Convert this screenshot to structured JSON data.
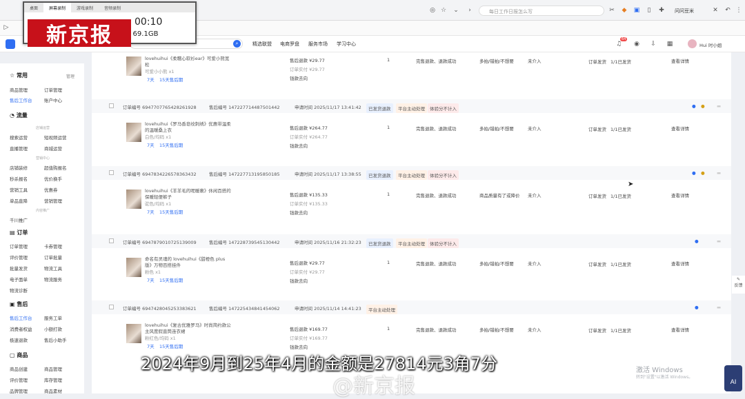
{
  "recorder": {
    "tabs": [
      "桌面",
      "屏幕录制",
      "游戏录制",
      "音频录制"
    ],
    "timer": "00:10",
    "storage": "/ 69.1GB"
  },
  "news_logo": "新京报",
  "browser": {
    "search_placeholder": "每日工作日报怎么写",
    "ext_text": "问问豆米"
  },
  "app": {
    "nav": [
      "精选联盟",
      "电商罗盘",
      "服务市场",
      "学习中心"
    ],
    "notif_count": "64",
    "user": "Hui 时小姐"
  },
  "sidebar": {
    "sections": [
      {
        "title": "常用",
        "extra": "管理"
      },
      {
        "title": "流量"
      },
      {
        "title": "订单"
      },
      {
        "title": "售后"
      },
      {
        "title": "商品"
      }
    ],
    "items_common": [
      "商品管理",
      "订单管理",
      "售后工作台",
      "账户中心"
    ],
    "items_traffic": [
      "搜索运营",
      "短视频运营",
      "直播管理",
      "商城运营",
      "店铺装修",
      "超值购报名",
      "秒杀报名",
      "优价换手",
      "营销工具",
      "优惠券",
      "单品直降",
      "营销管理",
      "千川推广"
    ],
    "hints": [
      "店铺运营",
      "营销中心",
      "内容推广"
    ],
    "items_order": [
      "订单管理",
      "卡券管理",
      "评价管理",
      "订单批量",
      "批量发货",
      "物流工具",
      "电子面单",
      "物流服务",
      "物流诊断"
    ],
    "items_after": [
      "售后工作台",
      "服务工单",
      "消费者权益",
      "小额打款",
      "极速退款",
      "售后小助手"
    ],
    "items_goods": [
      "商品创建",
      "商品管理",
      "评价管理",
      "库存管理",
      "品牌管理",
      "商品素材"
    ]
  },
  "orders": [
    {
      "order_no": "",
      "after_no": "",
      "apply_time": "",
      "badges": [],
      "title": "lovehuihui《柔糯心软衫ear》可爱小熊宽松",
      "spec": "可爱小小熊 x1",
      "days": "7天",
      "note": "15天售后期",
      "refund": "售后退款 ¥29.77",
      "paid": "订单实付 ¥29.77",
      "route": "钱款去向",
      "qty": "1",
      "status": "完售退款、退款成功",
      "reason": "多拍/错拍/不想要",
      "intervene": "未介入",
      "logistics": "订单发货",
      "progress": "1/1已发货",
      "action": "查看详情"
    },
    {
      "order_no": "订单编号 6947707765428261928",
      "after_no": "售后编号 147227714487501442",
      "apply_time": "申请时间 2025/11/17 13:41:42",
      "badges": [
        "已发货退款",
        "平台主动处理",
        "体验分不计入"
      ],
      "title": "lovehuihui《罗马香皂纹刺绣》优惠带温柔的温暖桑上衣",
      "spec": "白色/均码 x1",
      "days": "7天",
      "note": "15天售后期",
      "refund": "售后退款 ¥264.77",
      "paid": "订单实付 ¥264.77",
      "route": "钱款去向",
      "qty": "1",
      "status": "完售退款、退款成功",
      "reason": "多拍/错拍/不想要",
      "intervene": "未介入",
      "logistics": "订单发货",
      "progress": "1/1已发货",
      "action": "查看详情"
    },
    {
      "order_no": "订单编号 6947834226578363432",
      "after_no": "售后编号 147227713195850185",
      "apply_time": "申请时间 2025/11/17 13:38:55",
      "badges": [
        "已发货退款",
        "平台主动处理",
        "体验分不计入"
      ],
      "title": "lovehuihui《羊羊毛的呢暖裹》休闲百搭的保暖轻便裤子",
      "spec": "驼色/均码 x1",
      "days": "7天",
      "note": "15天售后期",
      "refund": "售后退款 ¥135.33",
      "paid": "订单实付 ¥135.33",
      "route": "钱款去向",
      "qty": "1",
      "status": "完售退款、退款成功",
      "reason": "商品质量有了或降价",
      "intervene": "未介入",
      "logistics": "订单发货",
      "progress": "1/1已发货",
      "action": "查看详情"
    },
    {
      "order_no": "订单编号 6947879010725139009",
      "after_no": "售后编号 147228739545130442",
      "apply_time": "申请时间 2025/11/16 21:32:23",
      "badges": [
        "已发货退款",
        "平台主动处理",
        "体验分不计入"
      ],
      "title": "命名有灵魂的 lovehuihui《甜橙色 plus版》万物百搭挂件",
      "spec": "粉色 x1",
      "days": "7天",
      "note": "15天售后期",
      "refund": "售后退款 ¥29.77",
      "paid": "订单实付 ¥29.77",
      "route": "钱款去向",
      "qty": "1",
      "status": "完售退款、退款成功",
      "reason": "多拍/错拍/不想要",
      "intervene": "未介入",
      "logistics": "订单发货",
      "progress": "1/1已发货",
      "action": "查看详情"
    },
    {
      "order_no": "订单编号 6947428045253383621",
      "after_no": "售后编号 147225434841454062",
      "apply_time": "申请时间 2025/11/14 14:41:23",
      "badges": [
        "平台主动处理"
      ],
      "title": "lovehuihui《复古优雅罗马》时尚简约款公主风度假直筒连衣裙",
      "spec": "粉红色/均码 x1",
      "days": "7天",
      "note": "15天售后期",
      "refund": "售后退款 ¥169.77",
      "paid": "订单实付 ¥169.77",
      "route": "钱款去向",
      "qty": "1",
      "status": "完售退款、退款成功",
      "reason": "多拍/错拍/不想要",
      "intervene": "未介入",
      "logistics": "订单发货",
      "progress": "1/1已发货",
      "action": "查看详情"
    }
  ],
  "subtitle": "2024年9月到25年4月的金额是27814元3角7分",
  "watermark": "@新京报",
  "windows_note": "激活 Windows",
  "windows_sub": "转到\"设置\"以激活 Windows。",
  "feedback": "反馈"
}
